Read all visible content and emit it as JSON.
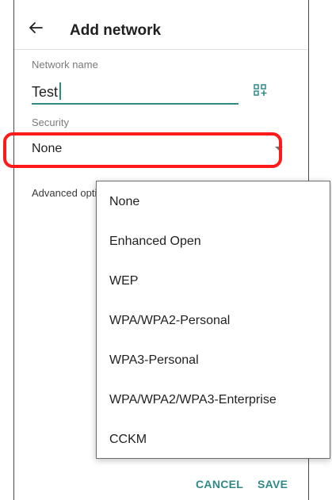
{
  "header": {
    "title": "Add network",
    "back_icon": "arrow-left-icon"
  },
  "network_name": {
    "label": "Network name",
    "value": "Test",
    "qr_icon": "qr-code-scan-icon"
  },
  "security": {
    "label": "Security",
    "selected": "None",
    "dropdown_icon": "dropdown-arrow-icon"
  },
  "advanced": {
    "label": "Advanced opti"
  },
  "menu": {
    "items": [
      {
        "label": "None"
      },
      {
        "label": "Enhanced Open"
      },
      {
        "label": "WEP"
      },
      {
        "label": "WPA/WPA2-Personal"
      },
      {
        "label": "WPA3-Personal"
      },
      {
        "label": "WPA/WPA2/WPA3-Enterprise"
      },
      {
        "label": "CCKM"
      }
    ]
  },
  "actions": {
    "cancel": "CANCEL",
    "save": "SAVE"
  },
  "colors": {
    "accent": "#2f8a86",
    "highlight": "#ff1a1a"
  }
}
